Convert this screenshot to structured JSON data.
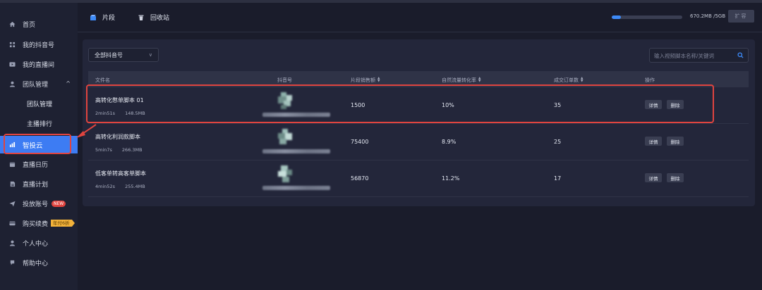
{
  "sidebar": {
    "items": [
      {
        "label": "首页",
        "icon": "home-icon"
      },
      {
        "label": "我的抖音号",
        "icon": "grid-icon"
      },
      {
        "label": "我的直播间",
        "icon": "live-room-icon"
      },
      {
        "label": "团队管理",
        "icon": "team-icon",
        "expanded": true
      },
      {
        "label": "团队管理",
        "sub": true
      },
      {
        "label": "主播排行",
        "sub": true
      },
      {
        "label": "智投云",
        "icon": "chart-icon",
        "active": true
      },
      {
        "label": "直播日历",
        "icon": "calendar-icon"
      },
      {
        "label": "直播计划",
        "icon": "plan-icon"
      },
      {
        "label": "投放账号",
        "icon": "send-icon",
        "badge": "NEW"
      },
      {
        "label": "购买续费",
        "icon": "card-icon",
        "badge": "年付6折"
      },
      {
        "label": "个人中心",
        "icon": "user-icon"
      },
      {
        "label": "帮助中心",
        "icon": "help-icon"
      }
    ]
  },
  "header": {
    "tabs": [
      {
        "label": "片段",
        "icon": "clip-icon"
      },
      {
        "label": "回收站",
        "icon": "trash-icon"
      }
    ],
    "storage_text": "670.2MB /5GB",
    "storage_fraction": 0.13,
    "expand_label": "扩容"
  },
  "toolbar": {
    "account_select": "全部抖音号",
    "search_placeholder": "输入视频脚本名称/关键词"
  },
  "table": {
    "columns": [
      "文件名",
      "抖音号",
      "片段销售额",
      "自然流量转化率",
      "成交订单数",
      "操作"
    ],
    "rows": [
      {
        "name": "高转化憋单脚本 01",
        "duration": "2min51s",
        "size": "148.5MB",
        "sales": "1500",
        "rate": "10%",
        "orders": "35"
      },
      {
        "name": "高转化利润款脚本",
        "duration": "5min7s",
        "size": "266.3MB",
        "sales": "75400",
        "rate": "8.9%",
        "orders": "25"
      },
      {
        "name": "低客单转高客单脚本",
        "duration": "4min52s",
        "size": "255.4MB",
        "sales": "56870",
        "rate": "11.2%",
        "orders": "17"
      }
    ],
    "action_detail": "详情",
    "action_delete": "删除"
  },
  "colors": {
    "accent": "#3d7cf3",
    "highlight": "#e0443f",
    "badge_new": "#e0443f",
    "badge_discount": "#f2b23a"
  }
}
